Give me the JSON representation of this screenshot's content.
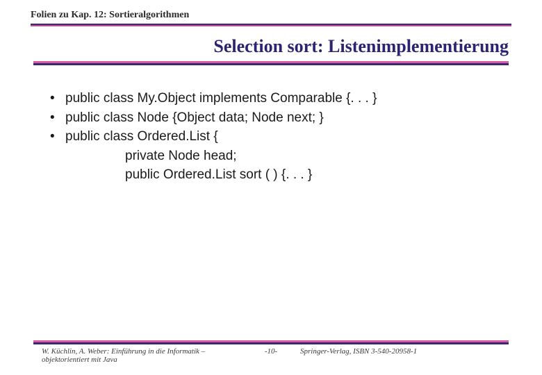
{
  "header": {
    "chapter_label": "Folien zu Kap. 12: Sortieralgorithmen"
  },
  "title": "Selection sort: Listenimplementierung",
  "bullets": {
    "b1": "public class My.Object implements Comparable {. . . }",
    "b2": "public class Node {Object data; Node next; }",
    "b3": "public class Ordered.List {",
    "b3_line2": "private Node head;",
    "b3_line3": "public Ordered.List sort ( ) {. . . }"
  },
  "footer": {
    "left": "W. Küchlin, A. Weber: Einführung in die Informatik – objektorientiert mit Java",
    "center": "-10-",
    "right": "Springer-Verlag, ISBN 3-540-20958-1"
  }
}
